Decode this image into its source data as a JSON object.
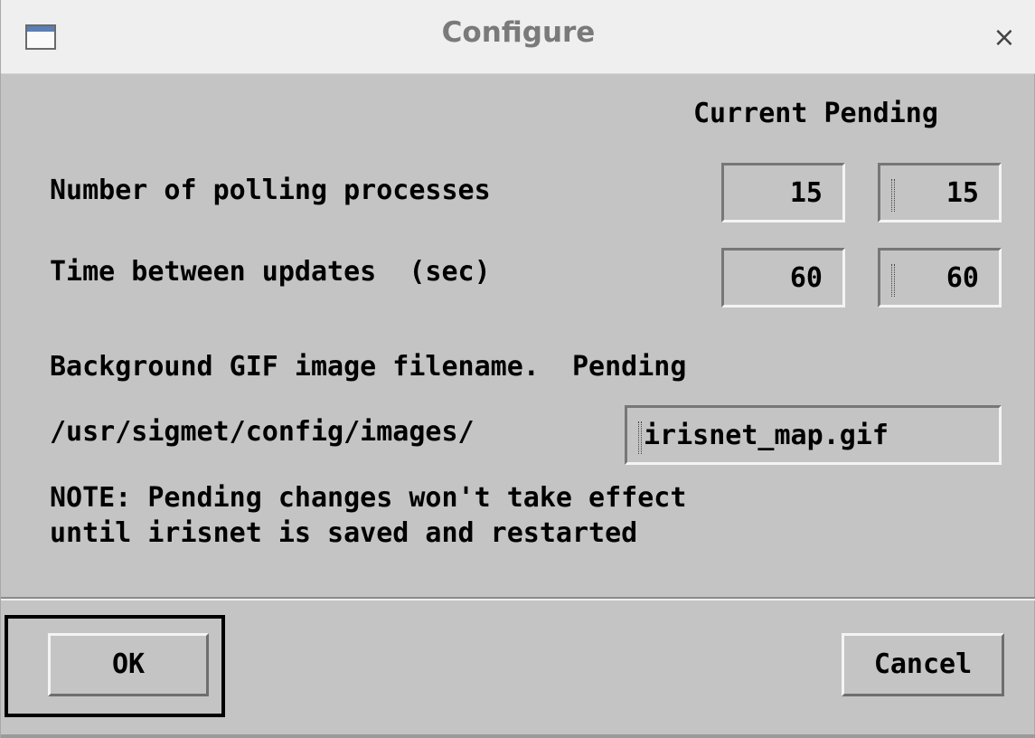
{
  "window": {
    "title": "Configure",
    "close_glyph": "×",
    "icon": "window-icon"
  },
  "columns": {
    "current_pending": "Current Pending"
  },
  "rows": [
    {
      "label": "Number of polling processes",
      "current": "15",
      "pending": "15"
    },
    {
      "label": "Time between updates  (sec)",
      "current": "60",
      "pending": "60"
    }
  ],
  "background": {
    "heading": "Background GIF image filename.  Pending",
    "path_prefix": "/usr/sigmet/config/images/",
    "filename": "irisnet_map.gif"
  },
  "note": {
    "line1": "NOTE: Pending changes won't take effect",
    "line2": "until irisnet is saved and restarted"
  },
  "buttons": {
    "ok": "OK",
    "cancel": "Cancel"
  }
}
